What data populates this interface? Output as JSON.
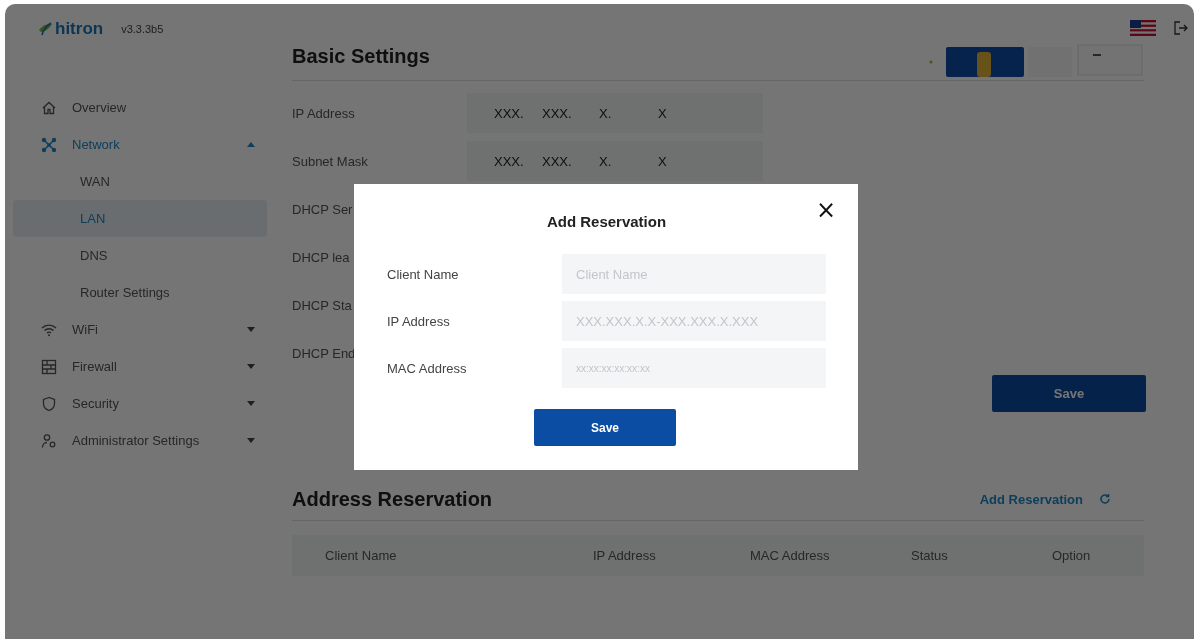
{
  "header": {
    "logo": "hitron",
    "version": "v3.3.3b5"
  },
  "sidebar": {
    "items": [
      {
        "label": "Overview",
        "selected": false
      },
      {
        "label": "Network",
        "selected": true,
        "expanded": true,
        "children": [
          {
            "label": "WAN",
            "selected": false
          },
          {
            "label": "LAN",
            "selected": true
          },
          {
            "label": "DNS",
            "selected": false
          },
          {
            "label": "Router Settings",
            "selected": false
          }
        ]
      },
      {
        "label": "WiFi",
        "selected": false,
        "expanded": false
      },
      {
        "label": "Firewall",
        "selected": false,
        "expanded": false
      },
      {
        "label": "Security",
        "selected": false,
        "expanded": false
      },
      {
        "label": "Administrator Settings",
        "selected": false,
        "expanded": false
      }
    ]
  },
  "basic_settings": {
    "title": "Basic Settings",
    "rows": [
      {
        "label": "IP Address",
        "value": [
          "XXX.",
          "XXX.",
          "X.",
          "X"
        ]
      },
      {
        "label": "Subnet Mask",
        "value": [
          "XXX.",
          "XXX.",
          "X.",
          "X"
        ]
      },
      {
        "label": "DHCP Ser"
      },
      {
        "label": "DHCP lea"
      },
      {
        "label": "DHCP Sta"
      },
      {
        "label": "DHCP End"
      }
    ],
    "save": "Save"
  },
  "address_reservation": {
    "title": "Address Reservation",
    "add_link": "Add Reservation",
    "columns": [
      "Client Name",
      "IP Address",
      "MAC Address",
      "Status",
      "Option"
    ]
  },
  "modal": {
    "title": "Add Reservation",
    "close": "×",
    "fields": [
      {
        "label": "Client Name",
        "placeholder": "Client Name"
      },
      {
        "label": "IP Address",
        "placeholder": "XXX.XXX.X.X-XXX.XXX.X.XXX"
      },
      {
        "label": "MAC Address",
        "placeholder": "xx:xx:xx:xx:xx:xx",
        "kind": "small"
      }
    ],
    "save": "Save"
  }
}
